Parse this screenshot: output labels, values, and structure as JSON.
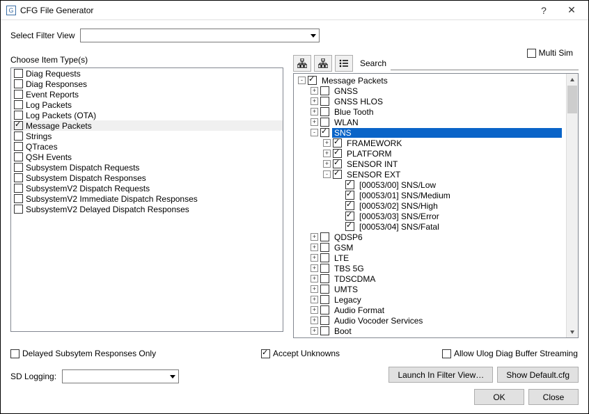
{
  "window": {
    "title": "CFG File Generator",
    "help": "?",
    "close": "✕"
  },
  "filter": {
    "label": "Select Filter View",
    "multisim": "Multi Sim"
  },
  "left": {
    "heading": "Choose Item Type(s)",
    "items": [
      {
        "label": "Diag Requests",
        "checked": false
      },
      {
        "label": "Diag Responses",
        "checked": false
      },
      {
        "label": "Event Reports",
        "checked": false
      },
      {
        "label": "Log Packets",
        "checked": false
      },
      {
        "label": "Log Packets (OTA)",
        "checked": false
      },
      {
        "label": "Message Packets",
        "checked": true
      },
      {
        "label": "Strings",
        "checked": false
      },
      {
        "label": "QTraces",
        "checked": false
      },
      {
        "label": "QSH Events",
        "checked": false
      },
      {
        "label": "Subsystem Dispatch Requests",
        "checked": false
      },
      {
        "label": "Subsystem Dispatch Responses",
        "checked": false
      },
      {
        "label": "SubsystemV2 Dispatch Requests",
        "checked": false
      },
      {
        "label": "SubsystemV2 Immediate Dispatch Responses",
        "checked": false
      },
      {
        "label": "SubsystemV2 Delayed Dispatch Responses",
        "checked": false
      }
    ]
  },
  "toolbar": {
    "search_label": "Search"
  },
  "tree": [
    {
      "indent": 0,
      "exp": "-",
      "checked": true,
      "label": "Message Packets"
    },
    {
      "indent": 1,
      "exp": "+",
      "checked": false,
      "label": "GNSS"
    },
    {
      "indent": 1,
      "exp": "+",
      "checked": false,
      "label": "GNSS HLOS"
    },
    {
      "indent": 1,
      "exp": "+",
      "checked": false,
      "label": "Blue Tooth"
    },
    {
      "indent": 1,
      "exp": "+",
      "checked": false,
      "label": "WLAN"
    },
    {
      "indent": 1,
      "exp": "-",
      "checked": true,
      "label": "SNS",
      "selected": true
    },
    {
      "indent": 2,
      "exp": "+",
      "checked": true,
      "label": "FRAMEWORK"
    },
    {
      "indent": 2,
      "exp": "+",
      "checked": true,
      "label": "PLATFORM"
    },
    {
      "indent": 2,
      "exp": "+",
      "checked": true,
      "label": "SENSOR INT"
    },
    {
      "indent": 2,
      "exp": "-",
      "checked": true,
      "label": "SENSOR EXT"
    },
    {
      "indent": 3,
      "exp": "",
      "checked": true,
      "label": "[00053/00] SNS/Low"
    },
    {
      "indent": 3,
      "exp": "",
      "checked": true,
      "label": "[00053/01] SNS/Medium"
    },
    {
      "indent": 3,
      "exp": "",
      "checked": true,
      "label": "[00053/02] SNS/High"
    },
    {
      "indent": 3,
      "exp": "",
      "checked": true,
      "label": "[00053/03] SNS/Error"
    },
    {
      "indent": 3,
      "exp": "",
      "checked": true,
      "label": "[00053/04] SNS/Fatal"
    },
    {
      "indent": 1,
      "exp": "+",
      "checked": false,
      "label": "QDSP6"
    },
    {
      "indent": 1,
      "exp": "+",
      "checked": false,
      "label": "GSM"
    },
    {
      "indent": 1,
      "exp": "+",
      "checked": false,
      "label": "LTE"
    },
    {
      "indent": 1,
      "exp": "+",
      "checked": false,
      "label": "TBS 5G"
    },
    {
      "indent": 1,
      "exp": "+",
      "checked": false,
      "label": "TDSCDMA"
    },
    {
      "indent": 1,
      "exp": "+",
      "checked": false,
      "label": "UMTS"
    },
    {
      "indent": 1,
      "exp": "+",
      "checked": false,
      "label": "Legacy"
    },
    {
      "indent": 1,
      "exp": "+",
      "checked": false,
      "label": "Audio Format"
    },
    {
      "indent": 1,
      "exp": "+",
      "checked": false,
      "label": "Audio Vocoder Services"
    },
    {
      "indent": 1,
      "exp": "+",
      "checked": false,
      "label": "Boot"
    }
  ],
  "options": {
    "delayed": "Delayed Subsytem Responses Only",
    "accept": "Accept Unknowns",
    "ulog": "Allow Ulog Diag Buffer Streaming",
    "sdlogging": "SD Logging:"
  },
  "buttons": {
    "launch": "Launch In Filter View…",
    "showdef": "Show Default.cfg",
    "ok": "OK",
    "close": "Close"
  }
}
